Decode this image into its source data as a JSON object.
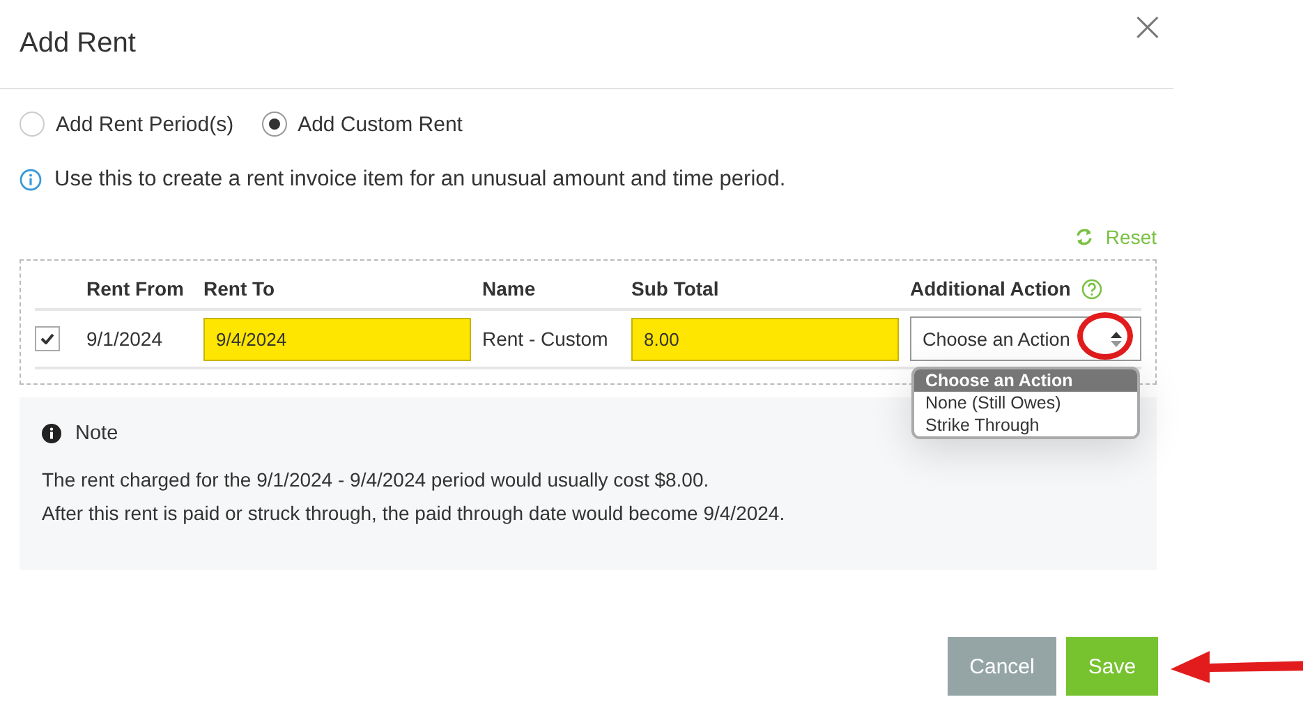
{
  "dialog": {
    "title": "Add Rent",
    "close": "×"
  },
  "modes": [
    {
      "label": "Add Rent Period(s)",
      "selected": false
    },
    {
      "label": "Add Custom Rent",
      "selected": true
    }
  ],
  "info": "Use this to create a rent invoice item for an unusual amount and time period.",
  "reset": "Reset",
  "table": {
    "columns": [
      "Rent From",
      "Rent To",
      "Name",
      "Sub Total",
      "Additional Action"
    ],
    "rows": [
      {
        "checked": true,
        "rent_from": "9/1/2024",
        "rent_to": {
          "value": "9/4/2024",
          "highlighted": true
        },
        "name": "Rent - Custom",
        "sub_total": {
          "value": "8.00",
          "highlighted": true
        },
        "action": {
          "value": "Choose an Action",
          "circled": true,
          "expanded": true,
          "options": [
            {
              "label": "Choose an Action",
              "selected": true
            },
            {
              "label": "None (Still Owes)",
              "selected": false
            },
            {
              "label": "Strike Through",
              "selected": false
            }
          ]
        }
      }
    ]
  },
  "note": {
    "title": "Note",
    "lines": [
      "The rent charged for the 9/1/2024 - 9/4/2024 period would usually cost $8.00.",
      "After this rent is paid or struck through, the paid through date would become 9/4/2024."
    ]
  },
  "buttons": [
    {
      "label": "Cancel",
      "kind": "cancel"
    },
    {
      "label": "Save",
      "kind": "primary",
      "pointed": true
    }
  ]
}
